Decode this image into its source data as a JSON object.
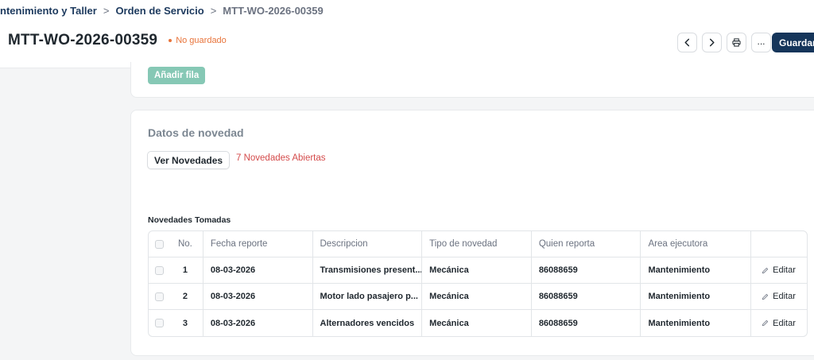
{
  "breadcrumb": {
    "items": [
      "ntenimiento y Taller",
      "Orden de Servicio"
    ],
    "current": "MTT-WO-2026-00359",
    "separator": ">"
  },
  "header": {
    "title": "MTT-WO-2026-00359",
    "status": "No guardado",
    "save_label": "Guardar",
    "more_label": "...",
    "icons": [
      "chevron-left-icon",
      "chevron-right-icon",
      "printer-icon",
      "more-icon"
    ]
  },
  "items_section": {
    "add_row_label": "Añadir fila"
  },
  "novedad_section": {
    "title": "Datos de novedad",
    "view_button": "Ver Novedades",
    "open_count_text": "7 Novedades Abiertas",
    "table_label": "Novedades Tomadas",
    "columns": [
      "No.",
      "Fecha reporte",
      "Descripcion",
      "Tipo de novedad",
      "Quien reporta",
      "Area ejecutora"
    ],
    "edit_label": "Editar",
    "rows": [
      {
        "no": "1",
        "fecha": "08-03-2026",
        "descripcion": "Transmisiones present...",
        "tipo": "Mecánica",
        "quien": "86088659",
        "area": "Mantenimiento"
      },
      {
        "no": "2",
        "fecha": "08-03-2026",
        "descripcion": "Motor lado pasajero p...",
        "tipo": "Mecánica",
        "quien": "86088659",
        "area": "Mantenimiento"
      },
      {
        "no": "3",
        "fecha": "08-03-2026",
        "descripcion": "Alternadores vencidos",
        "tipo": "Mecánica",
        "quien": "86088659",
        "area": "Mantenimiento"
      }
    ]
  },
  "colors": {
    "primary": "#15355a",
    "status_unsaved": "#e8743b",
    "open_count": "#d44b4b",
    "add_row_bg": "#86c8b5"
  }
}
